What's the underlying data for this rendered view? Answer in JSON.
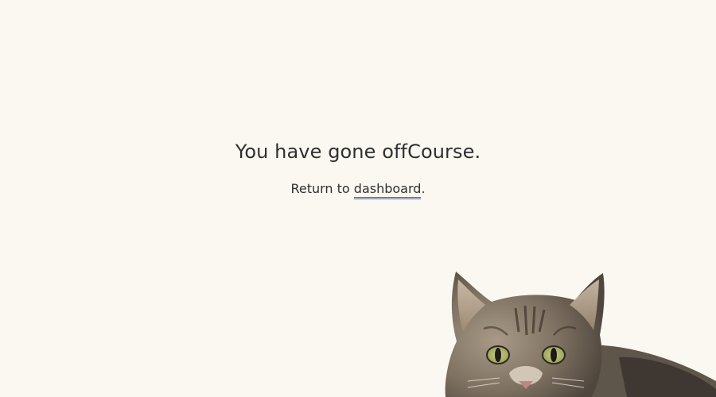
{
  "headline": "You have gone offCourse.",
  "subline": {
    "prefix": "Return to ",
    "link_label": "dashboard",
    "suffix": "."
  },
  "colors": {
    "background": "#fbf8f1",
    "text": "#2f2f2f",
    "link_underline": "#4a5a8a"
  },
  "illustration": "cat-peeking-image"
}
